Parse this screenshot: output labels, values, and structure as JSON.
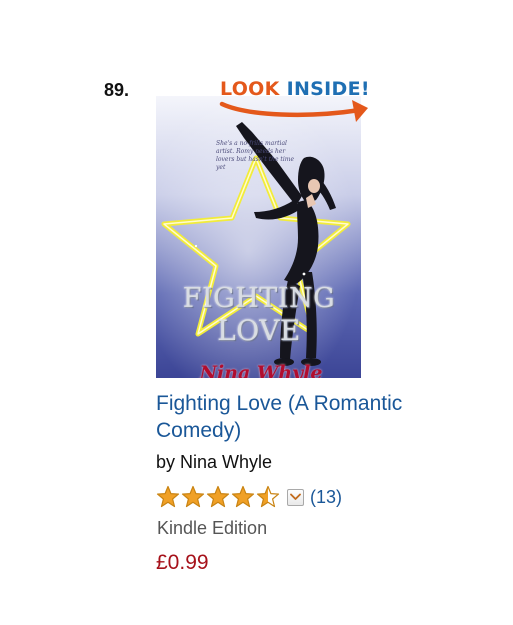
{
  "item": {
    "rank": "89.",
    "look_inside": {
      "word1": "LOOK",
      "word2": "INSIDE!"
    },
    "cover": {
      "title_line1": "FIGHTING",
      "title_line2": "LOVE",
      "author": "Nina Whyle",
      "tagline": "She's a no-frills martial artist. Romy needs her lovers but hasn't the time yet"
    },
    "title": "Fighting Love (A Romantic Comedy)",
    "author": "by Nina Whyle",
    "rating": {
      "stars": 4.5,
      "max_stars": 5,
      "review_count": "(13)"
    },
    "format": "Kindle Edition",
    "price": "£0.99"
  },
  "colors": {
    "link": "#1a5798",
    "price": "#a6111a",
    "star_fill": "#f0a026",
    "look_orange": "#e4581b",
    "look_blue": "#1f6fb3"
  },
  "icons": {
    "look_inside_arrow": "curved-arrow-icon",
    "rating": "star-icon",
    "dropdown": "chevron-down-icon"
  }
}
